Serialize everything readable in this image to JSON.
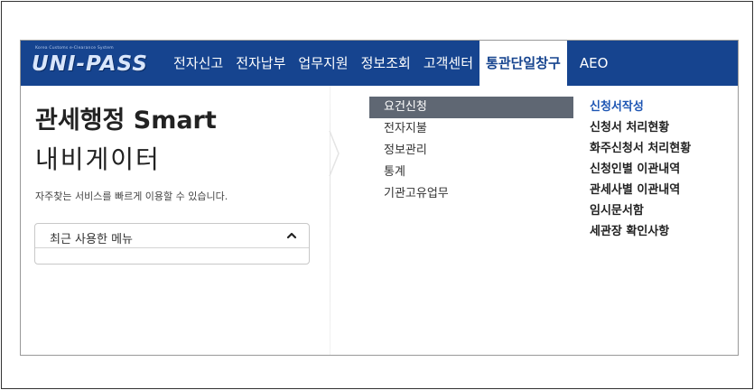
{
  "logo": {
    "tagline": "Korea Customs e-Clearance System",
    "name": "UNI-PASS"
  },
  "nav": {
    "items": [
      {
        "label": "전자신고"
      },
      {
        "label": "전자납부"
      },
      {
        "label": "업무지원"
      },
      {
        "label": "정보조회"
      },
      {
        "label": "고객센터"
      },
      {
        "label": "통관단일창구"
      },
      {
        "label": "AEO"
      }
    ],
    "active_index": 5
  },
  "left": {
    "title_line1": "관세행정 Smart",
    "title_line2": "내비게이터",
    "subtitle": "자주찾는 서비스를 빠르게 이용할 수 있습니다.",
    "recent_menu_label": "최근 사용한 메뉴"
  },
  "submenu": {
    "items": [
      {
        "label": "요건신청"
      },
      {
        "label": "전자지불"
      },
      {
        "label": "정보관리"
      },
      {
        "label": "통계"
      },
      {
        "label": "기관고유업무"
      }
    ],
    "active_index": 0
  },
  "detail_menu": {
    "items": [
      {
        "label": "신청서작성"
      },
      {
        "label": "신청서 처리현황"
      },
      {
        "label": "화주신청서 처리현황"
      },
      {
        "label": "신청인별 이관내역"
      },
      {
        "label": "관세사별 이관내역"
      },
      {
        "label": "임시문서함"
      },
      {
        "label": "세관장 확인사항"
      }
    ],
    "active_index": 0
  },
  "colors": {
    "nav_bg": "#16448f",
    "active_submenu_bg": "#5f6773",
    "active_link": "#1d55b3"
  }
}
